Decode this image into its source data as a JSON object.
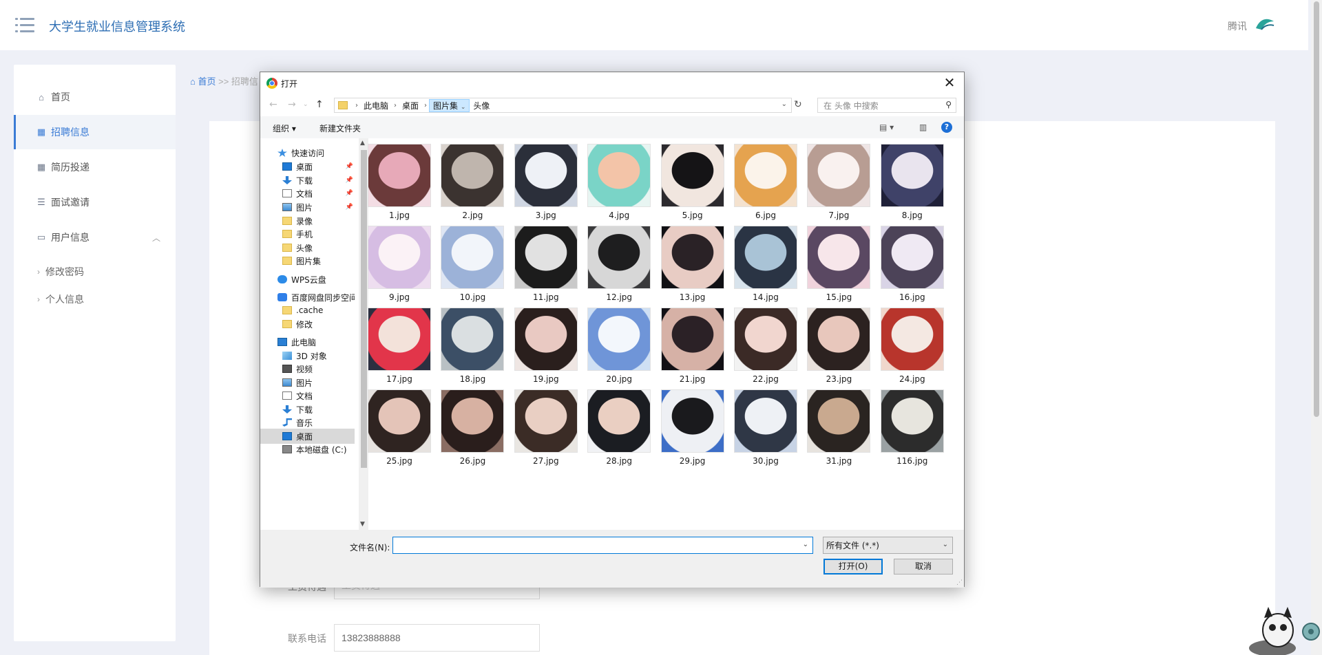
{
  "app": {
    "title": "大学生就业信息管理系统",
    "top_right_text": "腾讯",
    "sidebar": [
      {
        "label": "首页",
        "icon": "home-icon"
      },
      {
        "label": "招聘信息",
        "icon": "grid-icon"
      },
      {
        "label": "简历投递",
        "icon": "grid-icon"
      },
      {
        "label": "面试邀请",
        "icon": "list-icon"
      },
      {
        "label": "用户信息",
        "icon": "card-icon"
      }
    ],
    "sidebar_sub": [
      "修改密码",
      "个人信息"
    ],
    "breadcrumb": {
      "home": "首页",
      "sep": ">>",
      "current": "招聘信"
    },
    "form": {
      "salary_label": "工资待遇",
      "salary_placeholder": "工资待遇",
      "phone_label": "联系电话",
      "phone_value": "13823888888"
    }
  },
  "dialog": {
    "title": "打开",
    "close": "✕",
    "path": [
      "此电脑",
      "桌面",
      "图片集"
    ],
    "typed_path": "头像",
    "search_placeholder": "在 头像 中搜索",
    "toolbar": {
      "organize": "组织 ▾",
      "new_folder": "新建文件夹"
    },
    "nav_tree": [
      {
        "label": "快速访问",
        "icon": "star-icon",
        "pinned": false,
        "indent": 1
      },
      {
        "label": "桌面",
        "icon": "desktop-icon",
        "pinned": true,
        "indent": 2
      },
      {
        "label": "下载",
        "icon": "download-icon",
        "pinned": true,
        "indent": 2
      },
      {
        "label": "文档",
        "icon": "document-icon",
        "pinned": true,
        "indent": 2
      },
      {
        "label": "图片",
        "icon": "picture-icon",
        "pinned": true,
        "indent": 2
      },
      {
        "label": "录像",
        "icon": "folder-icon",
        "pinned": false,
        "indent": 2
      },
      {
        "label": "手机",
        "icon": "folder-icon",
        "pinned": false,
        "indent": 2
      },
      {
        "label": "头像",
        "icon": "folder-icon",
        "pinned": false,
        "indent": 2
      },
      {
        "label": "图片集",
        "icon": "folder-icon",
        "pinned": false,
        "indent": 2
      },
      {
        "label": "WPS云盘",
        "icon": "cloud-icon",
        "pinned": false,
        "indent": 1
      },
      {
        "label": "百度网盘同步空间",
        "icon": "baidu-icon",
        "pinned": false,
        "indent": 1
      },
      {
        "label": ".cache",
        "icon": "folder-icon",
        "pinned": false,
        "indent": 2
      },
      {
        "label": "修改",
        "icon": "folder-icon",
        "pinned": false,
        "indent": 2
      },
      {
        "label": "此电脑",
        "icon": "computer-icon",
        "pinned": false,
        "indent": 1
      },
      {
        "label": "3D 对象",
        "icon": "cube-icon",
        "pinned": false,
        "indent": 2
      },
      {
        "label": "视频",
        "icon": "video-icon",
        "pinned": false,
        "indent": 2
      },
      {
        "label": "图片",
        "icon": "picture-icon",
        "pinned": false,
        "indent": 2
      },
      {
        "label": "文档",
        "icon": "document-icon",
        "pinned": false,
        "indent": 2
      },
      {
        "label": "下载",
        "icon": "download-icon",
        "pinned": false,
        "indent": 2
      },
      {
        "label": "音乐",
        "icon": "music-icon",
        "pinned": false,
        "indent": 2
      },
      {
        "label": "桌面",
        "icon": "desktop-icon",
        "pinned": false,
        "indent": 2,
        "selected": true
      },
      {
        "label": "本地磁盘 (C:)",
        "icon": "disk-icon",
        "pinned": false,
        "indent": 2
      }
    ],
    "files": [
      {
        "name": "1.jpg",
        "colors": [
          "#f3dde4",
          "#6b3a3a",
          "#e7a9b8"
        ]
      },
      {
        "name": "2.jpg",
        "colors": [
          "#d9d2cc",
          "#3b3330",
          "#bfb5ad"
        ]
      },
      {
        "name": "3.jpg",
        "colors": [
          "#cfd6e2",
          "#2b2f3a",
          "#eef1f6"
        ]
      },
      {
        "name": "4.jpg",
        "colors": [
          "#e8f5f2",
          "#7ad4c7",
          "#f3c4a8"
        ]
      },
      {
        "name": "5.jpg",
        "colors": [
          "#2c2a2e",
          "#f1e6df",
          "#151416"
        ]
      },
      {
        "name": "6.jpg",
        "colors": [
          "#f4e2cf",
          "#e5a34f",
          "#fbf3ea"
        ]
      },
      {
        "name": "7.jpg",
        "colors": [
          "#efe6e6",
          "#b89d93",
          "#f9f1ef"
        ]
      },
      {
        "name": "8.jpg",
        "colors": [
          "#1f2038",
          "#3f4268",
          "#e9e4ee"
        ]
      },
      {
        "name": "9.jpg",
        "colors": [
          "#eedef0",
          "#d6bde3",
          "#fbf2f6"
        ]
      },
      {
        "name": "10.jpg",
        "colors": [
          "#dfe6f3",
          "#9cb2d8",
          "#f2f5fa"
        ]
      },
      {
        "name": "11.jpg",
        "colors": [
          "#c9c9c9",
          "#1c1c1c",
          "#e1e1e1"
        ]
      },
      {
        "name": "12.jpg",
        "colors": [
          "#3a3a3c",
          "#d7d7d7",
          "#1e1e1f"
        ]
      },
      {
        "name": "13.jpg",
        "colors": [
          "#101014",
          "#e8ccc4",
          "#2a2226"
        ]
      },
      {
        "name": "14.jpg",
        "colors": [
          "#d8e3ec",
          "#2a3444",
          "#a9c3d6"
        ]
      },
      {
        "name": "15.jpg",
        "colors": [
          "#f0d3dc",
          "#5a4862",
          "#f7e6ea"
        ]
      },
      {
        "name": "16.jpg",
        "colors": [
          "#d9d4e6",
          "#4c4358",
          "#efe9f3"
        ]
      },
      {
        "name": "17.jpg",
        "colors": [
          "#2c2f40",
          "#e2354a",
          "#f3e2da"
        ]
      },
      {
        "name": "18.jpg",
        "colors": [
          "#b9c0c4",
          "#3c4f66",
          "#dadfe1"
        ]
      },
      {
        "name": "19.jpg",
        "colors": [
          "#efe6e3",
          "#2a1f1d",
          "#e9c9c2"
        ]
      },
      {
        "name": "20.jpg",
        "colors": [
          "#cfe0f4",
          "#6f95d8",
          "#f3f7fc"
        ]
      },
      {
        "name": "21.jpg",
        "colors": [
          "#121015",
          "#d6b1a6",
          "#2b2126"
        ]
      },
      {
        "name": "22.jpg",
        "colors": [
          "#f2f2f2",
          "#3b2a26",
          "#f1d6cf"
        ]
      },
      {
        "name": "23.jpg",
        "colors": [
          "#e9e1dc",
          "#2c2220",
          "#e8c7bc"
        ]
      },
      {
        "name": "24.jpg",
        "colors": [
          "#f0d7cc",
          "#b8352c",
          "#f4e8e2"
        ]
      },
      {
        "name": "25.jpg",
        "colors": [
          "#e6e2df",
          "#2f2421",
          "#e4c4b8"
        ]
      },
      {
        "name": "26.jpg",
        "colors": [
          "#8a6d63",
          "#2a1e1c",
          "#d7b1a2"
        ]
      },
      {
        "name": "27.jpg",
        "colors": [
          "#e9e6e2",
          "#3b2c26",
          "#e9cfc3"
        ]
      },
      {
        "name": "28.jpg",
        "colors": [
          "#f1f2f5",
          "#1b1d22",
          "#eacfc2"
        ]
      },
      {
        "name": "29.jpg",
        "colors": [
          "#3d6ec7",
          "#eef0f4",
          "#1a1a1d"
        ]
      },
      {
        "name": "30.jpg",
        "colors": [
          "#c7d3e5",
          "#2f3746",
          "#eef1f5"
        ]
      },
      {
        "name": "31.jpg",
        "colors": [
          "#e7e3de",
          "#2a2421",
          "#c9a98f"
        ]
      },
      {
        "name": "116.jpg",
        "colors": [
          "#9aa1a3",
          "#2c2c2c",
          "#e7e5de"
        ]
      }
    ],
    "filename_label": "文件名(N):",
    "filename_value": "",
    "filter_value": "所有文件 (*.*)",
    "open_button": "打开(O)",
    "cancel_button": "取消"
  }
}
